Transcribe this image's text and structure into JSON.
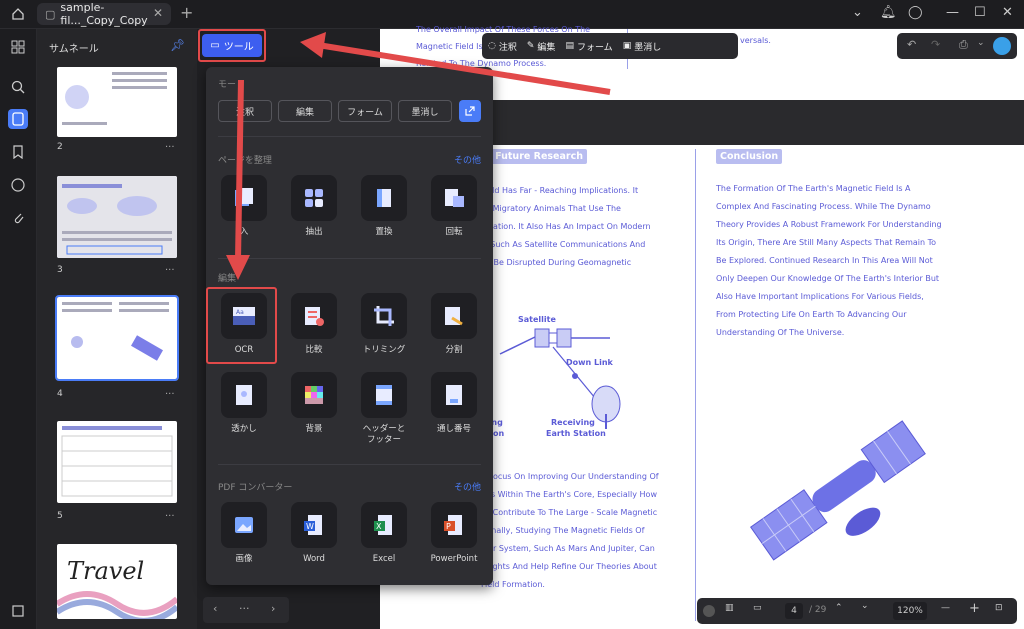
{
  "titlebar": {
    "tab_label": "sample-fil..._Copy_Copy",
    "tab_close": "✕",
    "tab_add": "+"
  },
  "thumbnail_panel": {
    "title": "サムネール",
    "pages": [
      "2",
      "3",
      "4",
      "5"
    ],
    "more": "···"
  },
  "tool_button": {
    "label": "ツール"
  },
  "float_toolbar": {
    "items": [
      "注釈",
      "編集",
      "フォーム",
      "墨消し"
    ]
  },
  "popup": {
    "mode_title": "モード",
    "modes": [
      "注釈",
      "編集",
      "フォーム",
      "墨消し"
    ],
    "organize": {
      "title": "ページを整理",
      "more": "その他",
      "items": [
        "入",
        "抽出",
        "置換",
        "回転"
      ]
    },
    "edit": {
      "title": "編集",
      "items": [
        "OCR",
        "比較",
        "トリミング",
        "分割",
        "透かし",
        "背景",
        "ヘッダーと\nフッター",
        "通し番号"
      ]
    },
    "converter": {
      "title": "PDF コンバーター",
      "more": "その他",
      "items": [
        "画像",
        "Word",
        "Excel",
        "PowerPoint"
      ]
    }
  },
  "panel_nav": {
    "dots": "···"
  },
  "document": {
    "top_lines": [
      "The Overall Impact Of These Forces On The",
      "Magnetic Field Is",
      "Related To The Dynamo Process.",
      "versals."
    ],
    "left_heading": "d Future Research",
    "left_text": [
      "Field Has Far - Reaching Implications. It",
      "Of Migratory Animals That Use The",
      "vigation. It Also Has An Impact On Modern",
      "s, Such As Satellite Communications And",
      "an Be Disrupted During Geomagnetic"
    ],
    "diagram": {
      "satellite": "Satellite",
      "downlink": "Down Link",
      "receiving": "Receiving",
      "station": "Earth Station",
      "tting": "tting",
      "ation": "ation"
    },
    "left_text2": [
      "d Focus On Improving Our Understanding Of",
      "ons Within The Earth's Core, Especially How",
      "es Contribute To The Large - Scale Magnetic",
      "tionally, Studying The Magnetic Fields Of",
      "olar System, Such As Mars And Jupiter, Can",
      "nsights And Help Refine Our Theories About",
      "Field Formation."
    ],
    "right_heading": "Conclusion",
    "right_text": [
      "The Formation Of The Earth's Magnetic Field Is A",
      "Complex And Fascinating Process. While The Dynamo",
      "Theory Provides A Robust Framework For Understanding",
      "Its Origin, There Are Still Many Aspects That Remain To",
      "Be Explored. Continued Research In This Area Will Not",
      "Only Deepen Our Knowledge Of The Earth's Interior But",
      "Also Have Important Implications For Various Fields,",
      "From Protecting Life On Earth To Advancing Our",
      "Understanding Of The Universe."
    ]
  },
  "bottombar": {
    "page": "4",
    "total": "/ 29",
    "zoom": "120%"
  },
  "colors": {
    "accent": "#4a7cf7",
    "annotation_red": "#e24a4a",
    "doc_text": "#5b5bd6"
  }
}
